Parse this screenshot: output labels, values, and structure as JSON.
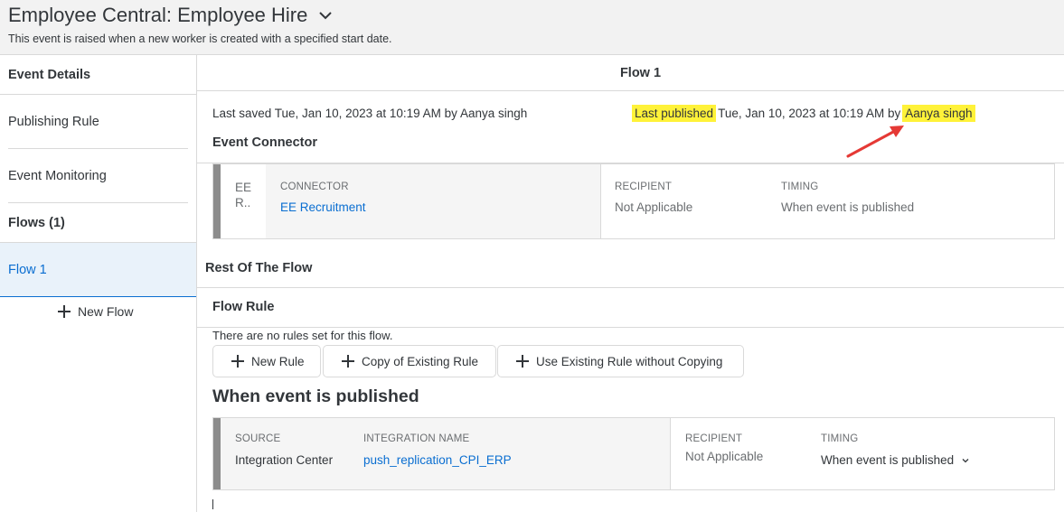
{
  "header": {
    "title": "Employee Central: Employee Hire",
    "subtitle": "This event is raised when a new worker is created with a specified start date."
  },
  "sidebar": {
    "event_details": "Event Details",
    "publishing_rule": "Publishing Rule",
    "event_monitoring": "Event Monitoring",
    "flows": "Flows (1)",
    "flow1": "Flow 1",
    "new_flow": "New Flow"
  },
  "main": {
    "flow_title": "Flow 1",
    "last_saved": "Last saved Tue, Jan 10, 2023 at 10:19 AM by Aanya singh",
    "last_published_label": "Last published",
    "last_published_mid": "Tue, Jan 10, 2023 at 10:19 AM by",
    "last_published_user": "Aanya singh",
    "event_connector_title": "Event Connector",
    "connector_card": {
      "abbrev_line1": "EE",
      "abbrev_line2": "R..",
      "connector_label": "CONNECTOR",
      "connector_value": "EE Recruitment",
      "recipient_label": "RECIPIENT",
      "recipient_value": "Not Applicable",
      "timing_label": "TIMING",
      "timing_value": "When event is published"
    },
    "rest_of_flow": "Rest Of The Flow",
    "flow_rule": "Flow Rule",
    "no_rules": "There are no rules set for this flow.",
    "buttons": {
      "new_rule": "New Rule",
      "copy_existing": "Copy of Existing Rule",
      "use_existing": "Use Existing Rule without Copying"
    },
    "when_published_title": "When event is published",
    "integration_card": {
      "source_label": "SOURCE",
      "source_value": "Integration Center",
      "integration_label": "INTEGRATION NAME",
      "integration_value": "push_replication_CPI_ERP",
      "recipient_label": "RECIPIENT",
      "recipient_value": "Not Applicable",
      "timing_label": "TIMING",
      "timing_value": "When event is published"
    }
  },
  "colors": {
    "highlight": "#fff239",
    "link": "#0a6ed1",
    "annotation_arrow": "#e53935"
  }
}
